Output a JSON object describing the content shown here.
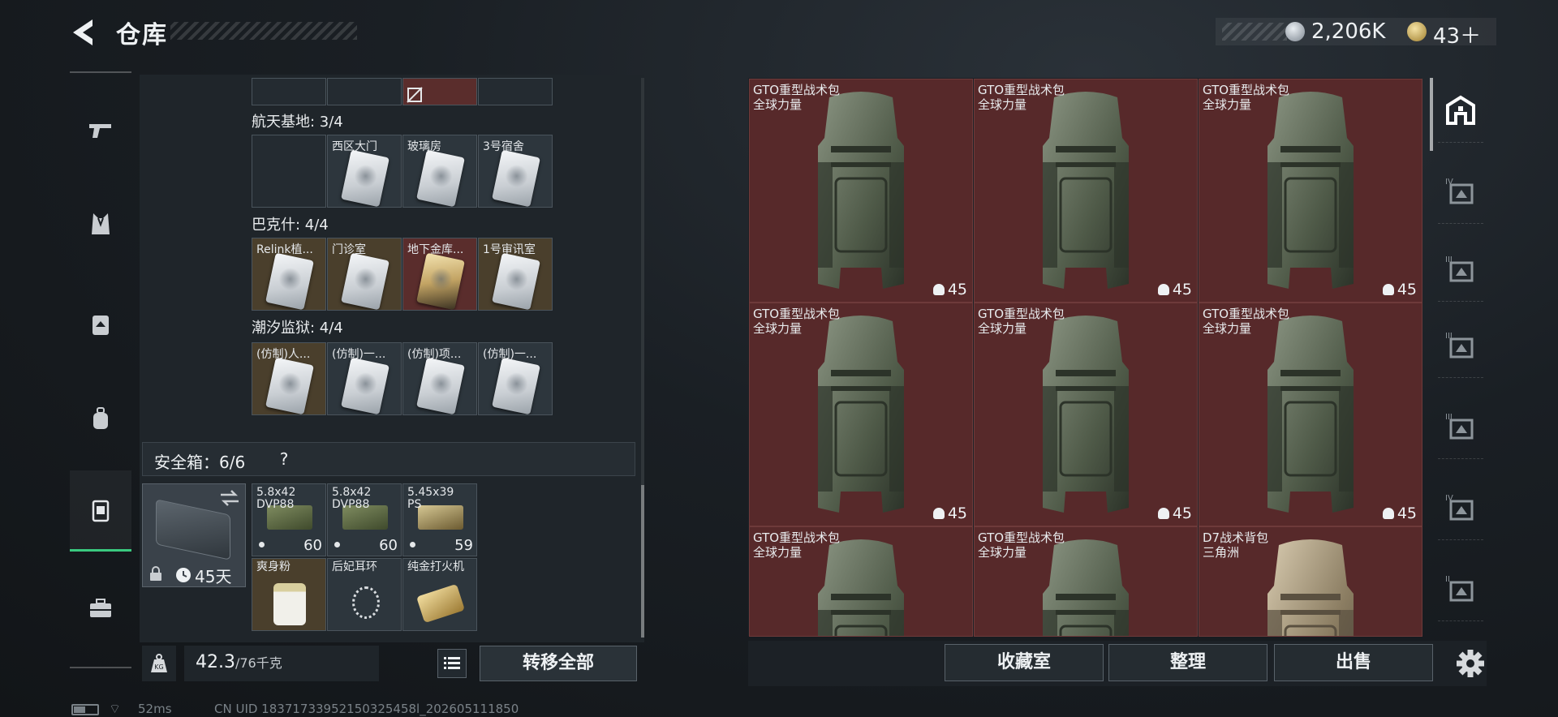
{
  "header": {
    "title": "仓库",
    "currency_silver": "2,206K",
    "currency_gold": "43＋"
  },
  "left_nav": {
    "items": [
      "pistol-icon",
      "vest-icon",
      "rig-icon",
      "backpack-icon",
      "case-icon",
      "toolbox-icon"
    ],
    "active_index": 4
  },
  "keys": {
    "top_row": [
      {
        "label": "",
        "style": "dark",
        "broken": false
      },
      {
        "label": "",
        "style": "dark",
        "broken": false
      },
      {
        "label": "",
        "style": "red",
        "broken": true
      },
      {
        "label": "",
        "style": "dark",
        "broken": false
      }
    ],
    "sections": [
      {
        "title": "航天基地: 3/4",
        "slots": [
          {
            "label": "",
            "style": "dark",
            "empty": true
          },
          {
            "label": "西区大门",
            "style": "normal",
            "broken": false
          },
          {
            "label": "玻璃房",
            "style": "normal",
            "broken": false
          },
          {
            "label": "3号宿舍",
            "style": "normal",
            "broken": false
          }
        ]
      },
      {
        "title": "巴克什: 4/4",
        "slots": [
          {
            "label": "Relink植...",
            "style": "gold",
            "broken": false
          },
          {
            "label": "门诊室",
            "style": "gold",
            "broken": true
          },
          {
            "label": "地下金库...",
            "style": "red",
            "broken": false,
            "gold_card": true
          },
          {
            "label": "1号审讯室",
            "style": "gold",
            "broken": false
          }
        ]
      },
      {
        "title": "潮汐监狱: 4/4",
        "slots": [
          {
            "label": "(仿制)人...",
            "style": "gold",
            "broken": false
          },
          {
            "label": "(仿制)一...",
            "style": "normal",
            "broken": false
          },
          {
            "label": "(仿制)项...",
            "style": "normal",
            "broken": false
          },
          {
            "label": "(仿制)一...",
            "style": "normal",
            "broken": false
          }
        ]
      }
    ]
  },
  "safebox": {
    "title": "安全箱：6/6",
    "help": "?",
    "days": "45天",
    "items": [
      {
        "label": "5.8x42\nDVP88",
        "count": "60",
        "type": "ammo"
      },
      {
        "label": "5.8x42\nDVP88",
        "count": "60",
        "type": "ammo"
      },
      {
        "label": "5.45x39\nPS",
        "count": "59",
        "type": "ammo-tan"
      },
      {
        "label": "爽身粉",
        "count": "",
        "type": "jar"
      },
      {
        "label": "后妃耳环",
        "count": "",
        "type": "earring"
      },
      {
        "label": "纯金打火机",
        "count": "",
        "type": "lighter"
      }
    ]
  },
  "bottom_left": {
    "weight": "42.3",
    "capacity": "/76千克",
    "transfer_label": "转移全部"
  },
  "storage": {
    "items": [
      {
        "name": "GTO重型战术包",
        "sub": "全球力量",
        "weight": "45",
        "tone": "green"
      },
      {
        "name": "GTO重型战术包",
        "sub": "全球力量",
        "weight": "45",
        "tone": "green"
      },
      {
        "name": "GTO重型战术包",
        "sub": "全球力量",
        "weight": "45",
        "tone": "green"
      },
      {
        "name": "GTO重型战术包",
        "sub": "全球力量",
        "weight": "45",
        "tone": "green"
      },
      {
        "name": "GTO重型战术包",
        "sub": "全球力量",
        "weight": "45",
        "tone": "green"
      },
      {
        "name": "GTO重型战术包",
        "sub": "全球力量",
        "weight": "45",
        "tone": "green"
      },
      {
        "name": "GTO重型战术包",
        "sub": "全球力量",
        "weight": "",
        "tone": "green"
      },
      {
        "name": "GTO重型战术包",
        "sub": "全球力量",
        "weight": "",
        "tone": "green"
      },
      {
        "name": "D7战术背包",
        "sub": "三角洲",
        "weight": "",
        "tone": "tan"
      }
    ],
    "buttons": {
      "collection": "收藏室",
      "sort": "整理",
      "sell": "出售"
    }
  },
  "right_nav": {
    "items": [
      {
        "icon": "home-storage-icon",
        "tier": ""
      },
      {
        "icon": "tier4-storage-icon",
        "tier": "IV"
      },
      {
        "icon": "tier3-storage-icon",
        "tier": "III"
      },
      {
        "icon": "tier3-rack-icon",
        "tier": "III"
      },
      {
        "icon": "tier3-box-icon",
        "tier": "III"
      },
      {
        "icon": "tier4-rack-icon",
        "tier": "IV"
      },
      {
        "icon": "tier2-box-icon",
        "tier": "II"
      }
    ]
  },
  "status_bar": {
    "ping": "52ms",
    "uid": "CN UID 18371733952150325458l_202605111850"
  },
  "colors": {
    "accent_green": "#3ac97f",
    "storage_cell": "#57292a"
  }
}
